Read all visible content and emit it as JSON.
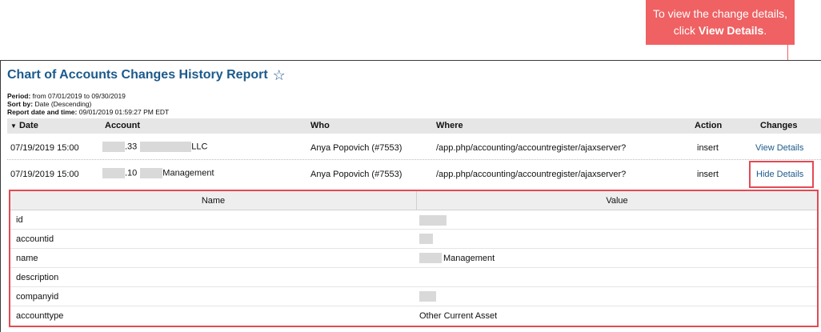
{
  "callout": {
    "line1": "To view the change details,",
    "line2_prefix": "click ",
    "line2_bold": "View Details",
    "line2_suffix": "."
  },
  "report": {
    "title": "Chart of Accounts Changes History Report",
    "period_label": "Period:",
    "period_value": "from 07/01/2019 to 09/30/2019",
    "sortby_label": "Sort by:",
    "sortby_value": "Date (Descending)",
    "datetime_label": "Report date and time:",
    "datetime_value": "09/01/2019 01:59:27 PM EDT"
  },
  "columns": {
    "date": "Date",
    "account": "Account",
    "who": "Who",
    "where": "Where",
    "action": "Action",
    "changes": "Changes"
  },
  "rows": [
    {
      "date": "07/19/2019 15:00",
      "account_mid": ".33",
      "account_suffix": "LLC",
      "who": "Anya Popovich (#7553)",
      "where": "/app.php/accounting/accountregister/ajaxserver?",
      "action": "insert",
      "changes": "View Details"
    },
    {
      "date": "07/19/2019 15:00",
      "account_mid": ".10",
      "account_suffix": "Management",
      "who": "Anya Popovich (#7553)",
      "where": "/app.php/accounting/accountregister/ajaxserver?",
      "action": "insert",
      "changes": "Hide Details"
    }
  ],
  "details": {
    "name_header": "Name",
    "value_header": "Value",
    "fields": [
      {
        "name": "id",
        "value": ""
      },
      {
        "name": "accountid",
        "value": ""
      },
      {
        "name": "name",
        "value": "Management"
      },
      {
        "name": "description",
        "value": ""
      },
      {
        "name": "companyid",
        "value": ""
      },
      {
        "name": "accounttype",
        "value": "Other Current Asset"
      }
    ]
  },
  "colors": {
    "accent_link": "#1c5a8c",
    "callout_bg": "#ef6163",
    "highlight_border": "#e24b54"
  }
}
